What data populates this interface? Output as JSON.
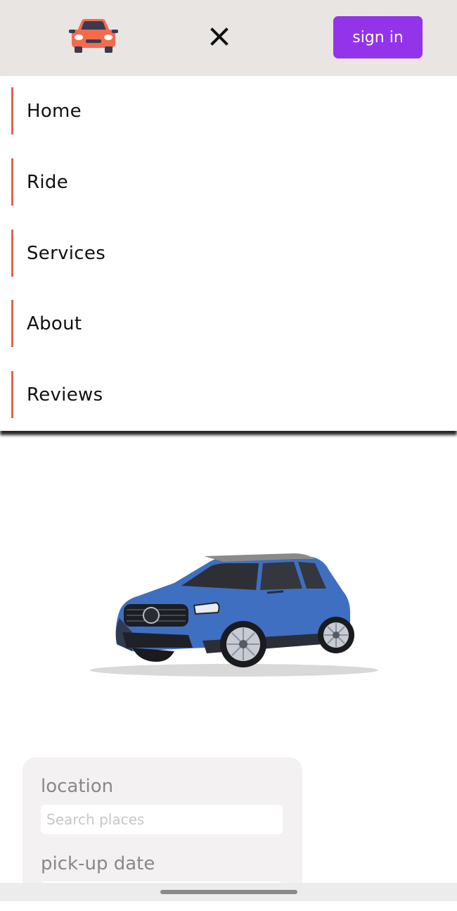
{
  "header": {
    "logo_icon": "car-front-icon",
    "close_icon": "close-icon",
    "signin_label": "sign in"
  },
  "menu": {
    "items": [
      {
        "label": "Home"
      },
      {
        "label": "Ride"
      },
      {
        "label": "Services"
      },
      {
        "label": "About"
      },
      {
        "label": "Reviews"
      }
    ]
  },
  "hero": {
    "image": "blue-suv-illustration"
  },
  "booking": {
    "location_label": "location",
    "location_placeholder": "Search places",
    "pickup_label": "pick-up date"
  },
  "colors": {
    "header_bg": "#e8e5e3",
    "accent_purple": "#9333ea",
    "menu_accent": "#e0644f",
    "card_bg": "#f3f1f1"
  }
}
